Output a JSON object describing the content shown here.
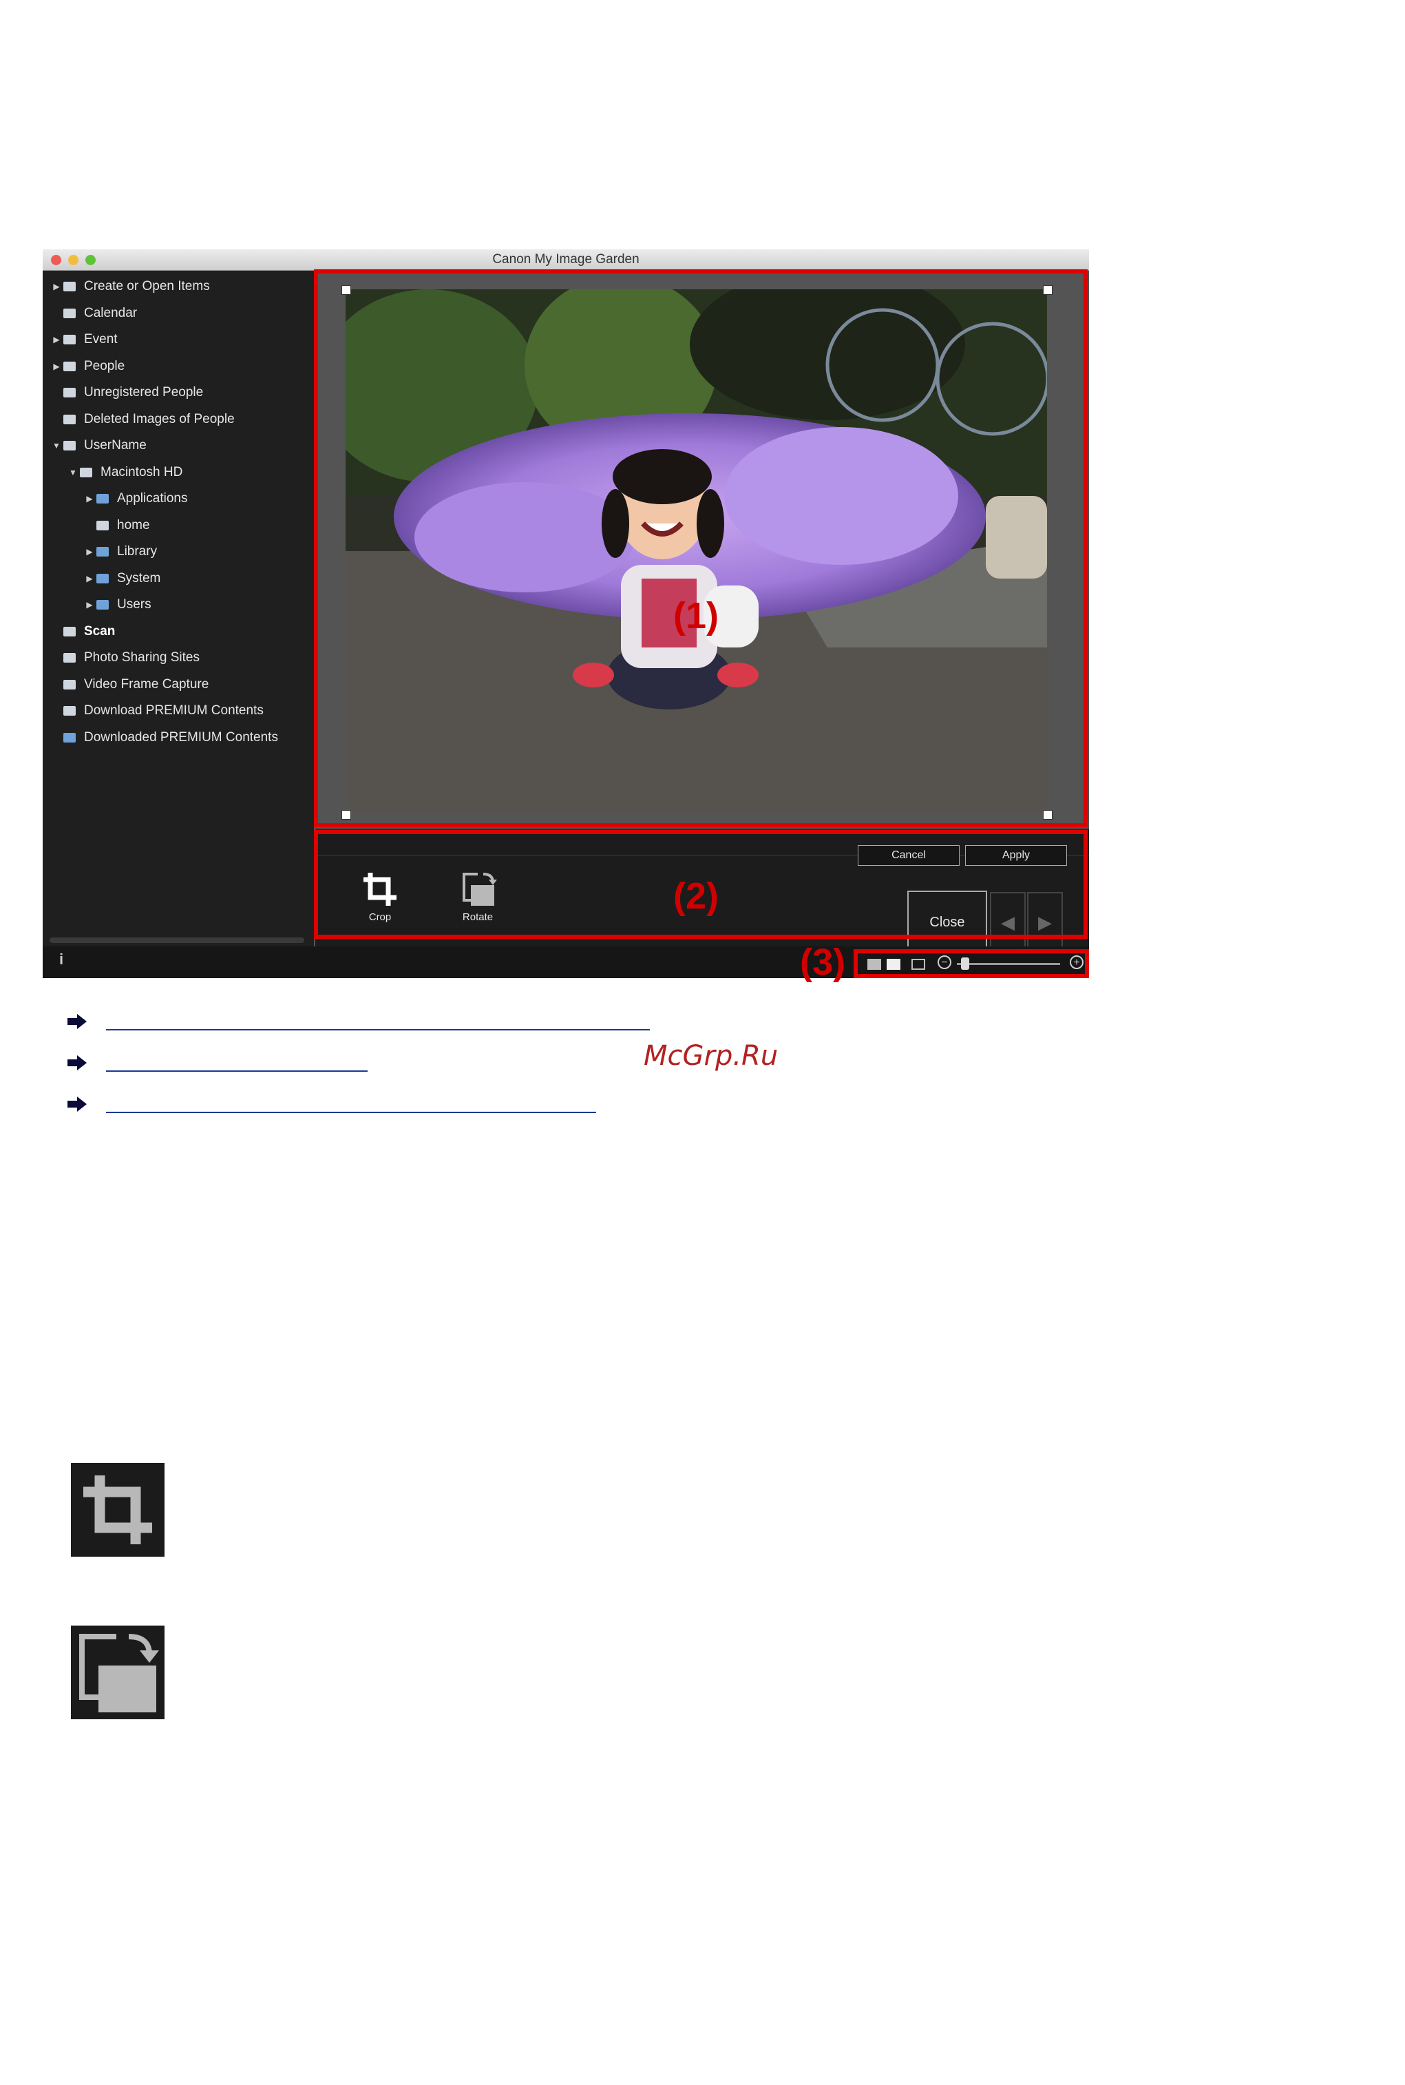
{
  "window": {
    "title": "Canon My Image Garden",
    "traffic_lights": [
      "#ee5b54",
      "#f3bd3b",
      "#5fc23a"
    ]
  },
  "sidebar": {
    "items": [
      {
        "label": "Create or Open Items",
        "icon": "create-icon",
        "expander": "right"
      },
      {
        "label": "Calendar",
        "icon": "calendar-icon",
        "expander": ""
      },
      {
        "label": "Event",
        "icon": "event-icon",
        "expander": "right"
      },
      {
        "label": "People",
        "icon": "people-icon",
        "expander": "right"
      },
      {
        "label": "Unregistered People",
        "icon": "unregistered-people-icon",
        "expander": ""
      },
      {
        "label": "Deleted Images of People",
        "icon": "deleted-people-icon",
        "expander": ""
      },
      {
        "label": "UserName",
        "icon": "computer-icon",
        "expander": "down"
      },
      {
        "label": "Macintosh HD",
        "icon": "hard-drive-icon",
        "expander": "down"
      },
      {
        "label": "Applications",
        "icon": "folder-icon",
        "expander": "right"
      },
      {
        "label": "home",
        "icon": "home-drive-icon",
        "expander": ""
      },
      {
        "label": "Library",
        "icon": "folder-icon",
        "expander": "right"
      },
      {
        "label": "System",
        "icon": "folder-icon",
        "expander": "right"
      },
      {
        "label": "Users",
        "icon": "folder-icon",
        "expander": "right"
      },
      {
        "label": "Scan",
        "icon": "scan-icon",
        "expander": ""
      },
      {
        "label": "Photo Sharing Sites",
        "icon": "photo-sharing-icon",
        "expander": ""
      },
      {
        "label": "Video Frame Capture",
        "icon": "video-frame-icon",
        "expander": ""
      },
      {
        "label": "Download PREMIUM Contents",
        "icon": "download-icon",
        "expander": ""
      },
      {
        "label": "Downloaded PREMIUM Contents",
        "icon": "downloaded-folder-icon",
        "expander": ""
      }
    ]
  },
  "annotations": {
    "area1": "(1)",
    "area2": "(2)",
    "area3": "(3)",
    "color": "#e00000"
  },
  "editbar": {
    "cancel_label": "Cancel",
    "apply_label": "Apply",
    "crop_label": "Crop",
    "rotate_label": "Rotate",
    "close_label": "Close",
    "prev_icon": "left-arrow-icon",
    "next_icon": "right-arrow-icon"
  },
  "statusbar": {
    "info_label": "i",
    "zoom_out_label": "−",
    "zoom_in_label": "+",
    "zoom_level": 0.03
  },
  "links": {
    "count": 3,
    "color": "#1a3a8f"
  },
  "watermark": "McGrp.Ru",
  "big_icons": [
    "crop-icon",
    "rotate-icon"
  ]
}
